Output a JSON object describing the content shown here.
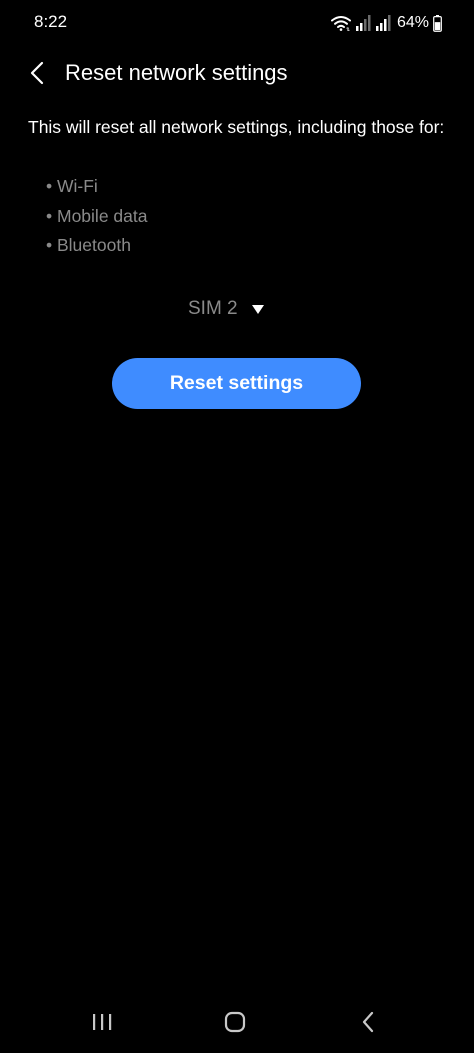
{
  "status_bar": {
    "time": "8:22",
    "battery_percent": "64%",
    "icons": [
      "wifi-icon",
      "signal-sim1-icon",
      "signal-sim2-icon",
      "battery-icon"
    ],
    "battery_level": 0.64
  },
  "header": {
    "title": "Reset network settings",
    "back_icon": "chevron-left-icon"
  },
  "content": {
    "description": "This will reset all network settings, including those for:",
    "items": [
      "Wi-Fi",
      "Mobile data",
      "Bluetooth"
    ],
    "bullet": "•"
  },
  "sim_selector": {
    "selected": "SIM 2",
    "icon": "dropdown-arrow-icon"
  },
  "reset_button": {
    "label": "Reset settings"
  },
  "nav_bar": {
    "icons": [
      "recents-icon",
      "home-icon",
      "back-icon"
    ]
  },
  "colors": {
    "background": "#000000",
    "accent": "#3f8cff",
    "secondary_text": "#8a8a8a",
    "primary_text": "#ffffff"
  }
}
